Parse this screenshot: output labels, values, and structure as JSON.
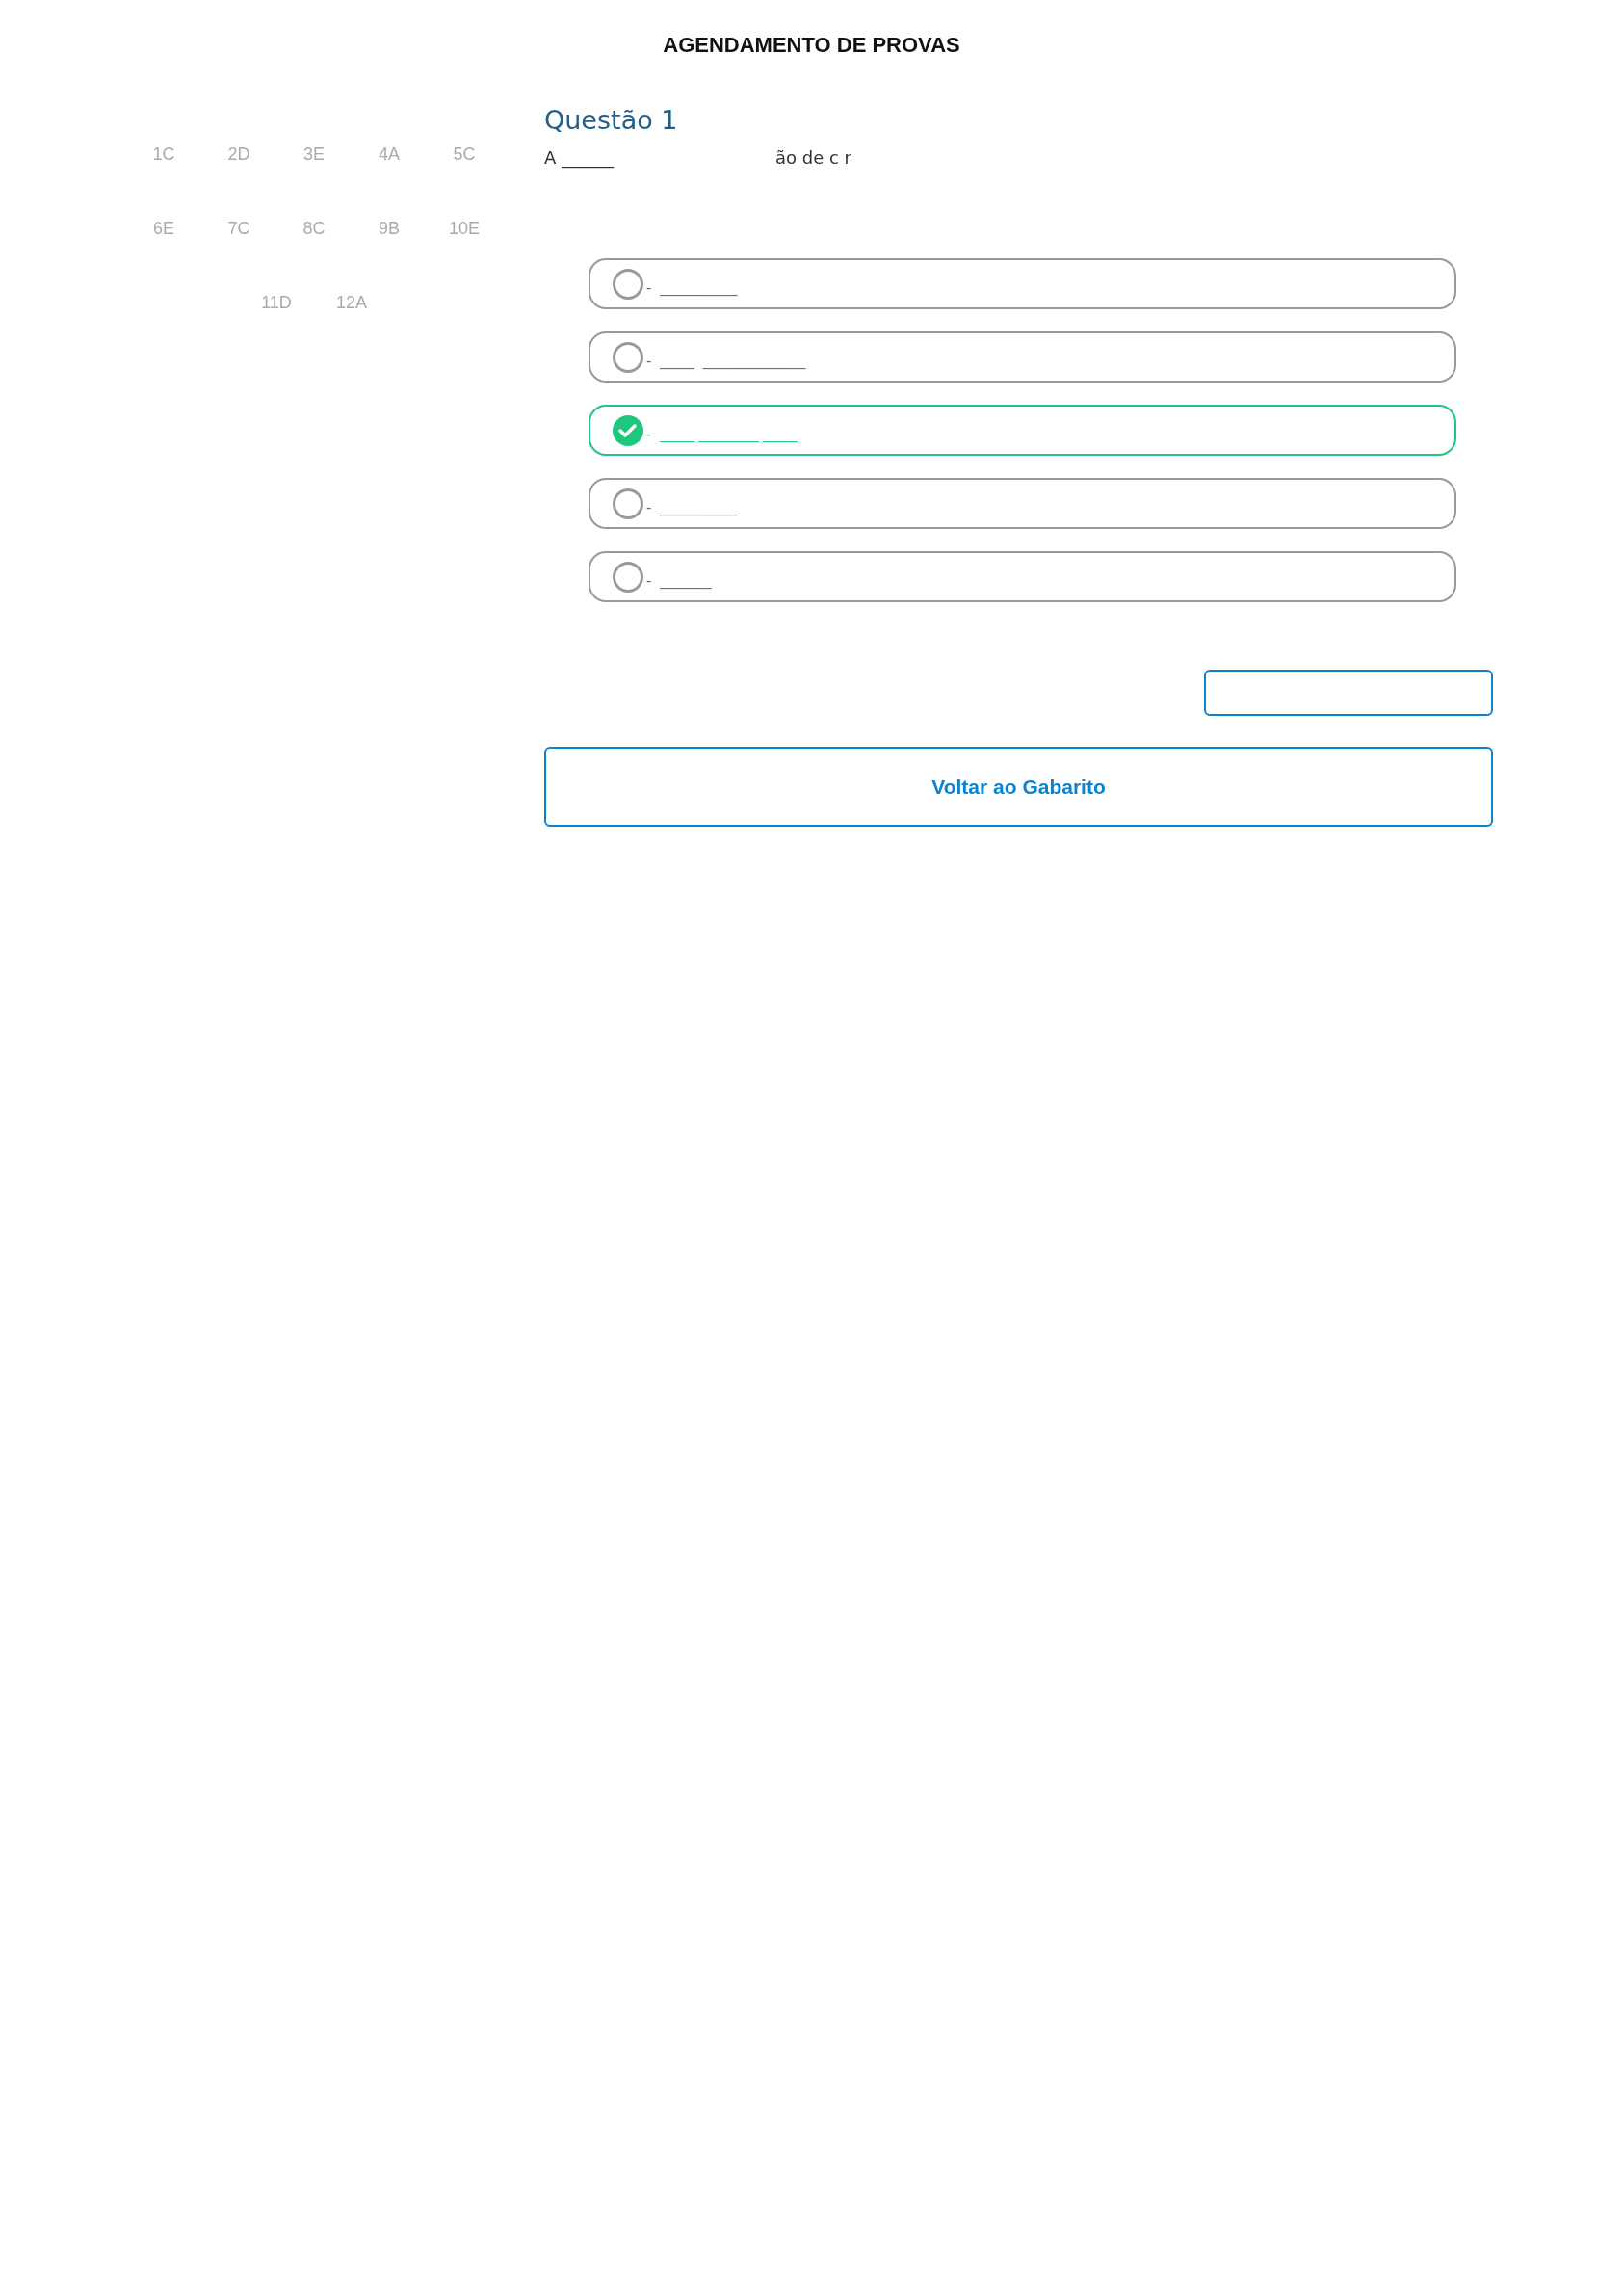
{
  "header": {
    "title": "AGENDAMENTO DE PROVAS"
  },
  "answer_key": [
    {
      "label": "1C"
    },
    {
      "label": "2D"
    },
    {
      "label": "3E"
    },
    {
      "label": "4A"
    },
    {
      "label": "5C"
    },
    {
      "label": "6E"
    },
    {
      "label": "7C"
    },
    {
      "label": "8C"
    },
    {
      "label": "9B"
    },
    {
      "label": "10E"
    },
    {
      "label": "11D"
    },
    {
      "label": "12A"
    }
  ],
  "question": {
    "title": "Questão 1",
    "text_start": "A ______",
    "text_end": "ão de c  r"
  },
  "options": [
    {
      "text": "-  _________",
      "selected": false
    },
    {
      "text": "-  ____  ____________",
      "selected": false
    },
    {
      "text": "-  ____ _______ ____",
      "selected": true
    },
    {
      "text": "-  _________",
      "selected": false
    },
    {
      "text": "-  ______",
      "selected": false
    }
  ],
  "buttons": [
    {
      "kind": "blank"
    },
    {
      "kind": "labeled",
      "label": "Voltar ao Gabarito"
    }
  ]
}
